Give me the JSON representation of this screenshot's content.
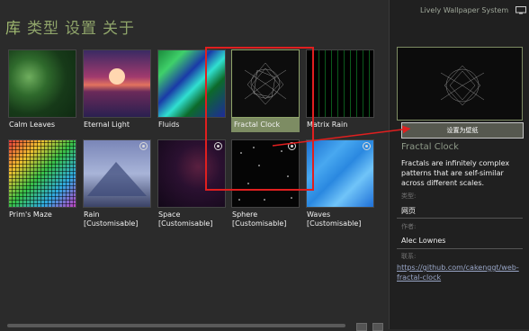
{
  "nav": [
    "库",
    "类型",
    "设置",
    "关于"
  ],
  "tiles": [
    {
      "label": "Calm Leaves"
    },
    {
      "label": "Eternal Light"
    },
    {
      "label": "Fluids"
    },
    {
      "label": "Fractal Clock"
    },
    {
      "label": "Matrix Rain"
    },
    {
      "label": "Prim's Maze"
    },
    {
      "label": "Rain [Customisable]"
    },
    {
      "label": "Space\n[Customisable]"
    },
    {
      "label": "Sphere\n[Customisable]"
    },
    {
      "label": "Waves\n[Customisable]"
    }
  ],
  "side": {
    "app_title": "Lively Wallpaper System",
    "set_button": "设置为壁纸",
    "title": "Fractal Clock",
    "description": "Fractals are infinitely complex patterns that are self-similar across different scales.",
    "type_label": "类型:",
    "type_value": "网页",
    "author_label": "作者:",
    "author_value": "Alec Lownes",
    "contact_label": "联系:",
    "contact_value": "https://github.com/cakenggt/web-fractal-clock"
  },
  "colors": {
    "accent": "#8fa46a",
    "annotation": "#e01f1f"
  }
}
